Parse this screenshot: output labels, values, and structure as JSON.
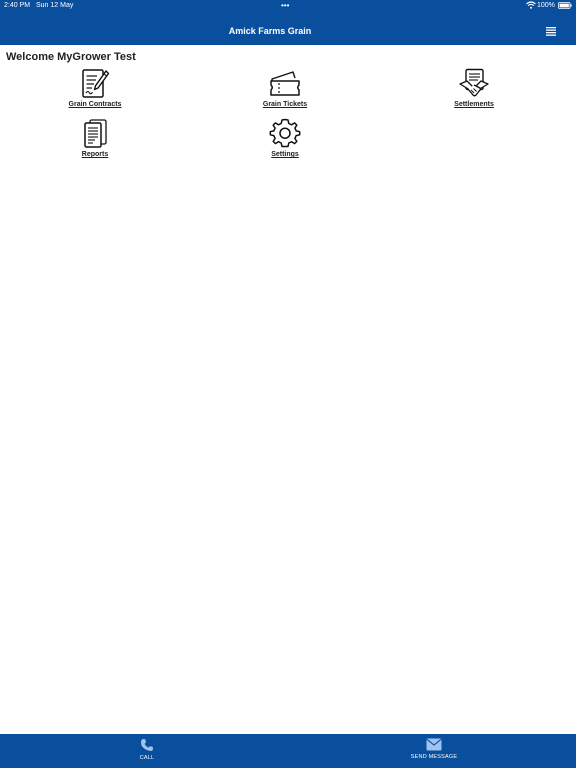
{
  "status_bar": {
    "time": "2:40 PM",
    "date": "Sun 12 May",
    "dots": "•••",
    "battery": "100%"
  },
  "header": {
    "title": "Amick Farms Grain",
    "menu_icon": "hamburger-menu-icon",
    "background_color": "#0a4f9e"
  },
  "welcome_text": "Welcome MyGrower Test",
  "tiles": [
    {
      "label": "Grain Contracts",
      "icon": "contract-document-icon"
    },
    {
      "label": "Grain Tickets",
      "icon": "ticket-icon"
    },
    {
      "label": "Settlements",
      "icon": "handshake-document-icon"
    },
    {
      "label": "Reports",
      "icon": "report-documents-icon"
    },
    {
      "label": "Settings",
      "icon": "gear-icon"
    }
  ],
  "bottom_bar": {
    "call_label": "CALL",
    "call_icon": "phone-icon",
    "message_label": "SEND MESSAGE",
    "message_icon": "envelope-icon"
  }
}
